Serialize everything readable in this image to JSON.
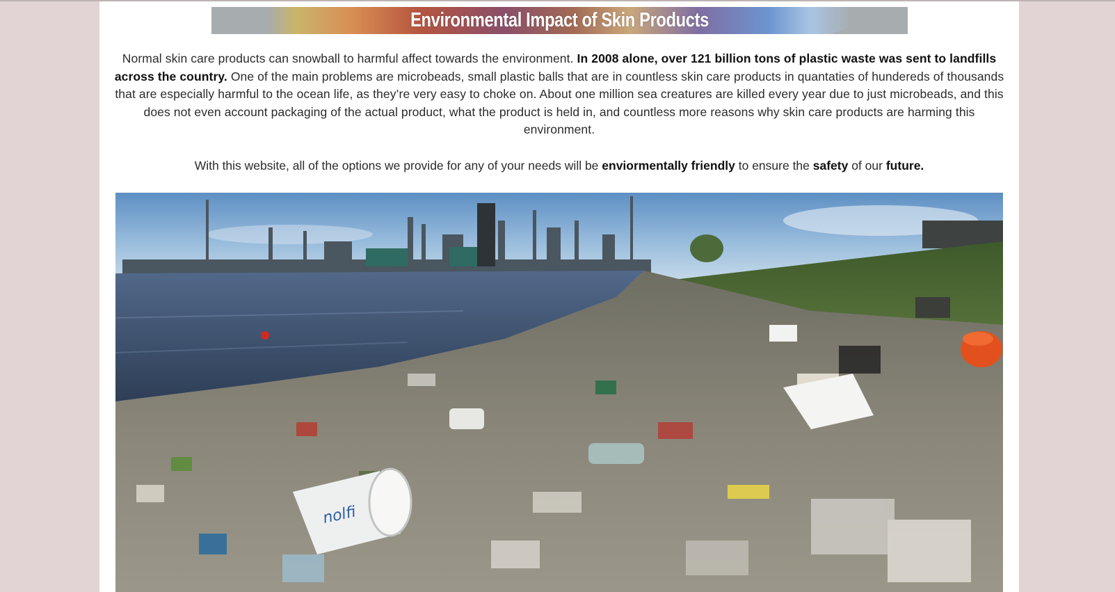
{
  "section": {
    "title": "Environmental Impact of Skin Products"
  },
  "intro": {
    "part1": "Normal skin care products can snowball to harmful affect towards the environment. ",
    "bold1": "In 2008 alone, over 121 billion tons of plastic waste was sent to landfills across the country.",
    "part2": " One of the main problems are microbeads, small plastic balls that are in countless skin care products in quantaties of hundereds of thousands that are especially harmful to the ocean life, as they’re very easy to choke on. About one million sea creatures are killed every year due to just microbeads, and this does not even account packaging of the actual product, what the product is held in, and countless more reasons why skin care products are harming this environment."
  },
  "mission": {
    "part1": "With this website, all of the options we provide for any of your needs will be ",
    "bold1": "enviormentally friendly",
    "part2": " to ensure the ",
    "bold2": "safety",
    "part3": " of our ",
    "bold3": "future."
  },
  "colors": {
    "page_bg": "#e2d4d4",
    "content_bg": "#ffffff",
    "banner_grey": "#a7acae"
  }
}
